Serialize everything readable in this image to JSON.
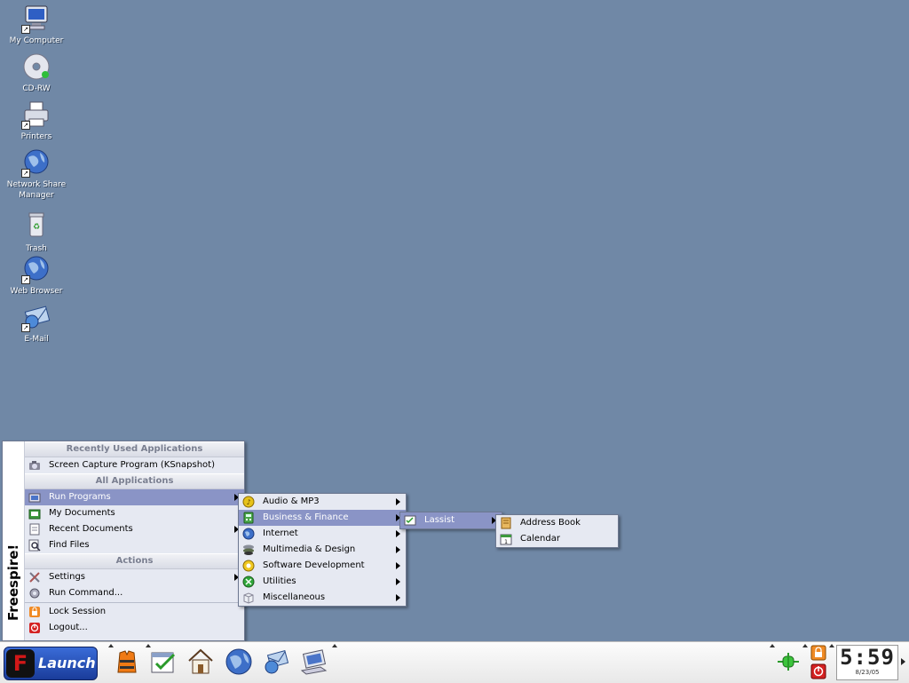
{
  "desktop_icons": [
    {
      "label": "My Computer",
      "icon": "monitor-icon"
    },
    {
      "label": "CD-RW",
      "icon": "cd-icon"
    },
    {
      "label": "Printers",
      "icon": "printer-icon"
    },
    {
      "label": "Network Share Manager",
      "icon": "globe-icon"
    },
    {
      "label": "Trash",
      "icon": "trash-icon"
    },
    {
      "label": "Web Browser",
      "icon": "globe-icon"
    },
    {
      "label": "E-Mail",
      "icon": "mail-icon"
    }
  ],
  "launch_menu": {
    "brand": "Freespire!",
    "recent_header": "Recently Used Applications",
    "recent_items": [
      "Screen Capture Program (KSnapshot)"
    ],
    "all_header": "All Applications",
    "main_items": [
      "Run Programs",
      "My Documents",
      "Recent Documents",
      "Find Files"
    ],
    "actions_header": "Actions",
    "action_items": [
      "Settings",
      "Run Command...",
      "Lock Session",
      "Logout..."
    ]
  },
  "programs_submenu": [
    "Audio & MP3",
    "Business & Finance",
    "Internet",
    "Multimedia & Design",
    "Software Development",
    "Utilities",
    "Miscellaneous"
  ],
  "business_submenu": [
    "Lassist"
  ],
  "lassist_submenu": [
    "Address Book",
    "Calendar"
  ],
  "taskbar": {
    "launch_label": "Launch",
    "launch_letter": "F",
    "clock_time": "5:59",
    "clock_date": "8/23/05"
  }
}
